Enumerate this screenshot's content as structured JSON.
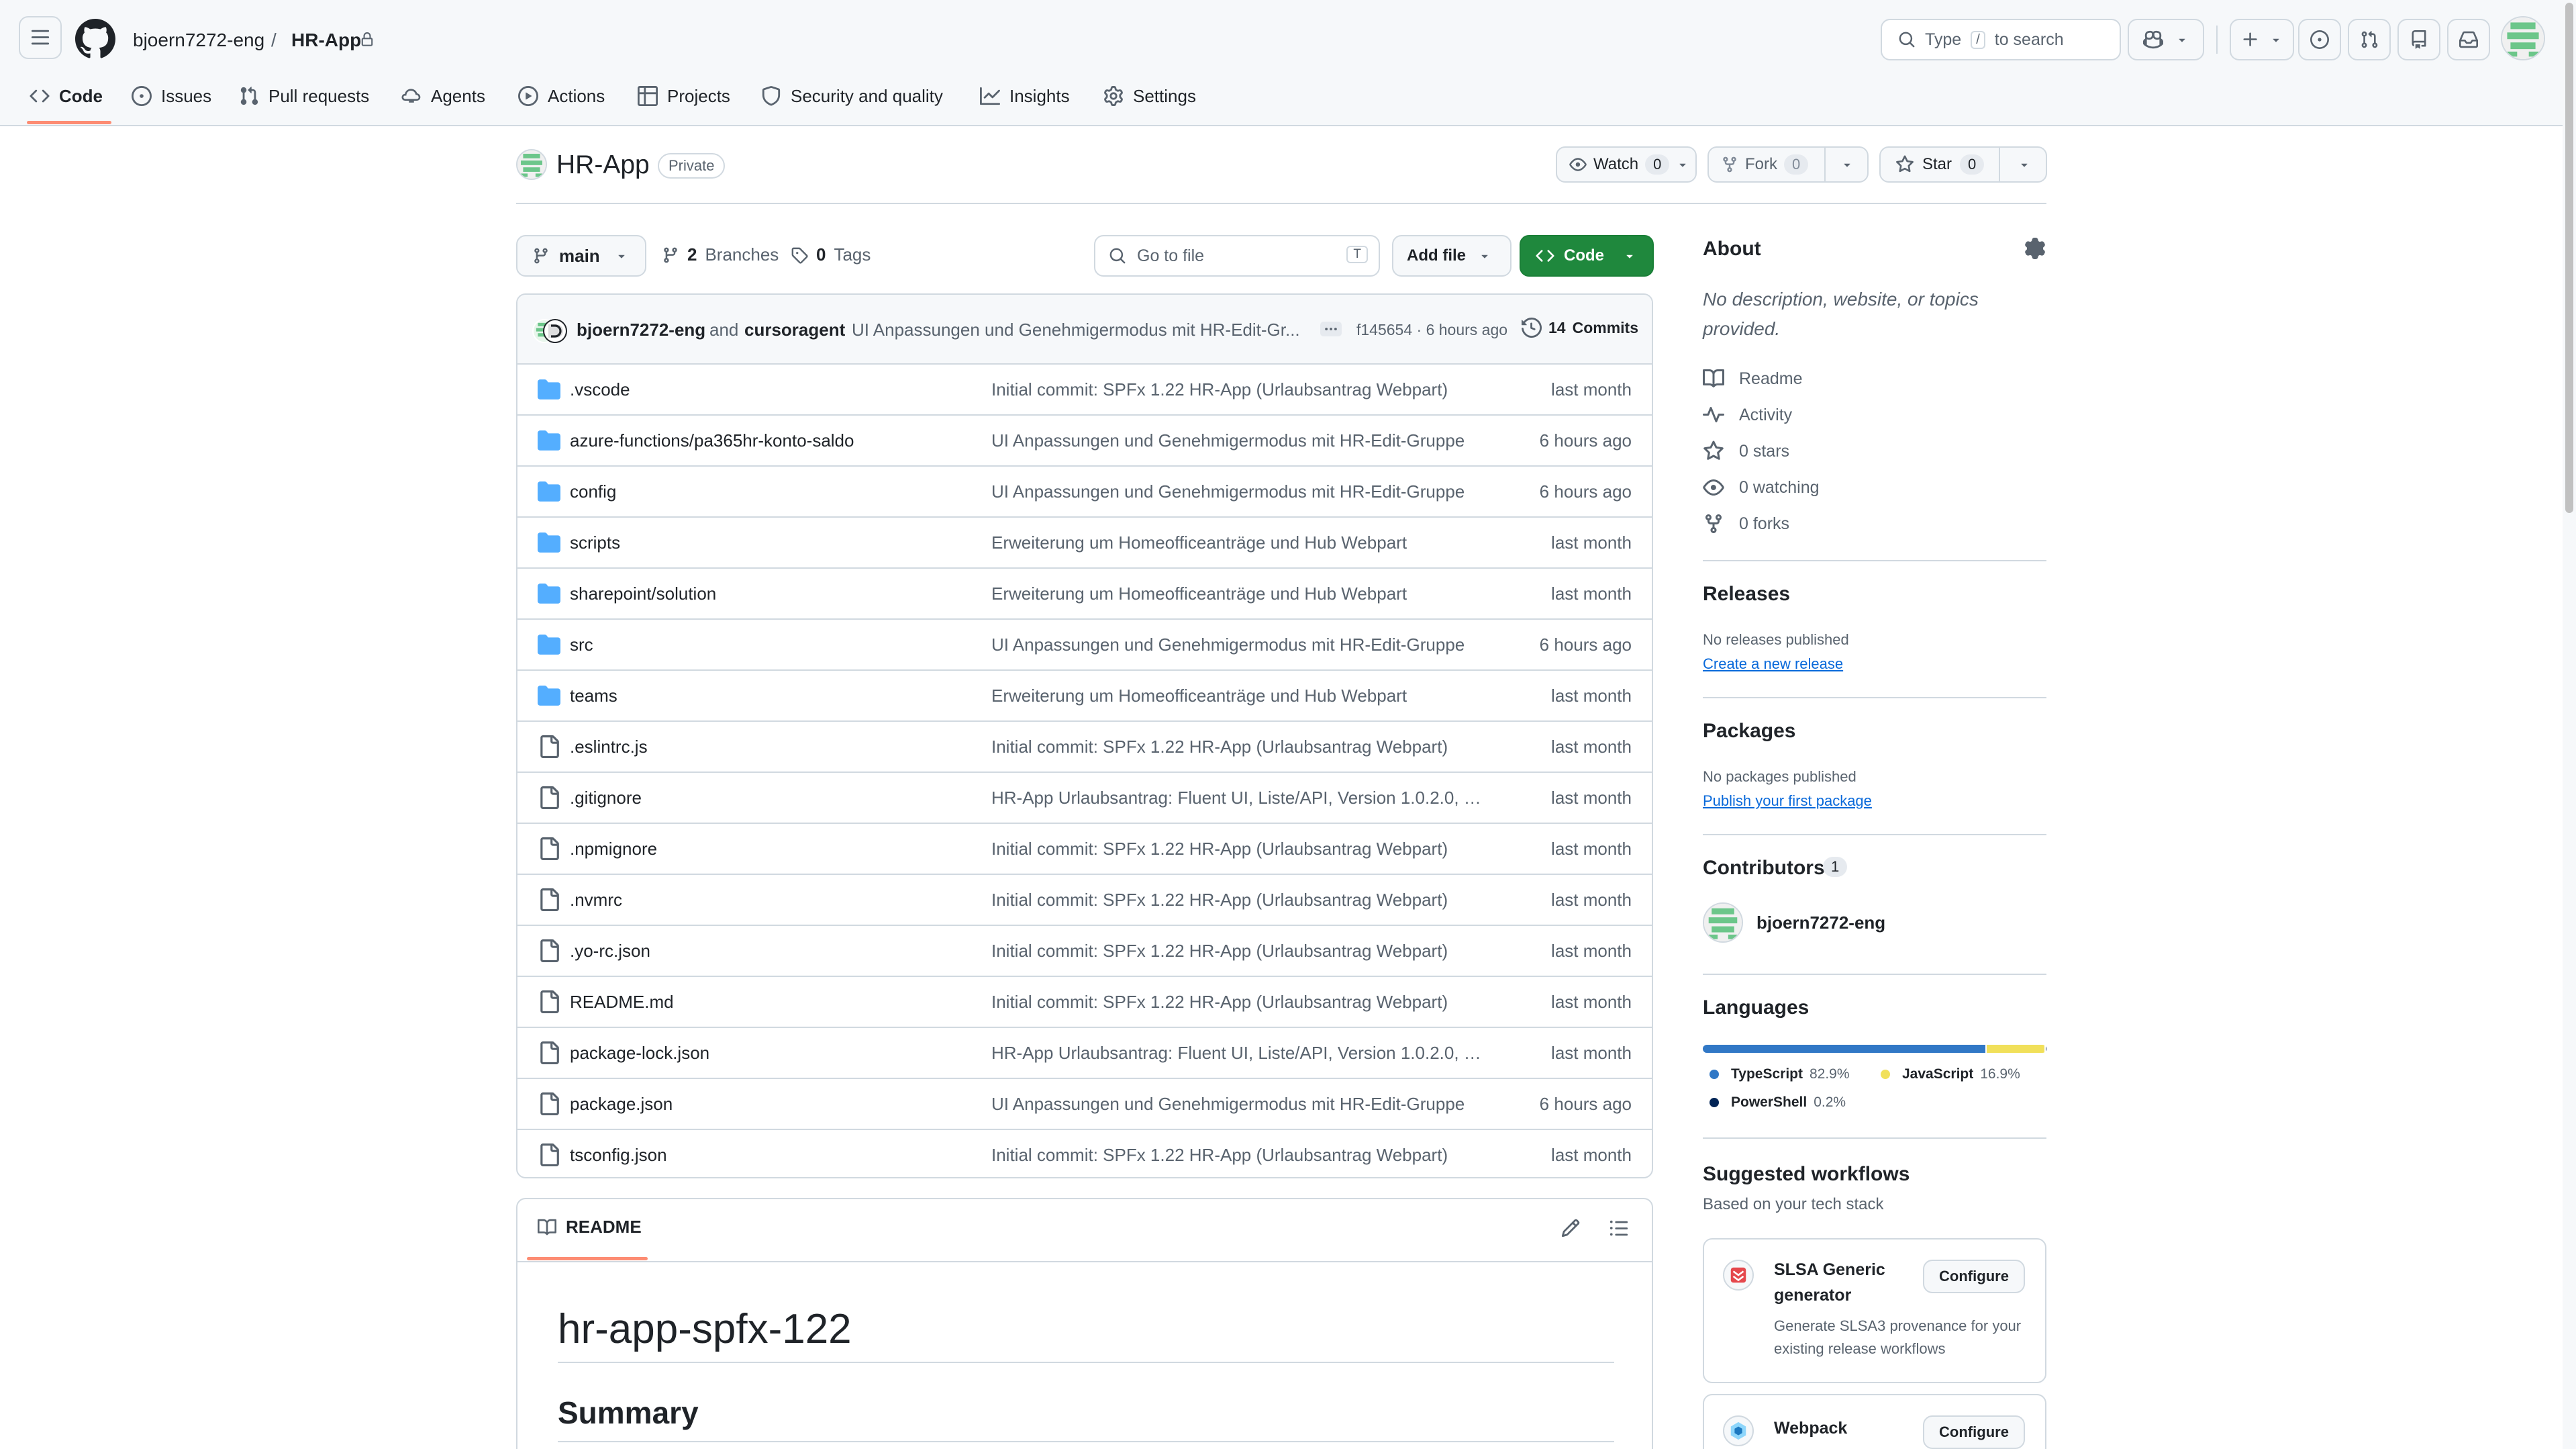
{
  "header": {
    "owner": "bjoern7272-eng",
    "separator": "/",
    "repo": "HR-App",
    "search_prefix": "Type",
    "search_key": "/",
    "search_suffix": "to search"
  },
  "tabs": [
    {
      "label": "Code",
      "icon": "code-icon"
    },
    {
      "label": "Issues",
      "icon": "issue-icon"
    },
    {
      "label": "Pull requests",
      "icon": "pull-request-icon"
    },
    {
      "label": "Agents",
      "icon": "agent-icon"
    },
    {
      "label": "Actions",
      "icon": "play-icon"
    },
    {
      "label": "Projects",
      "icon": "table-icon"
    },
    {
      "label": "Security and quality",
      "icon": "shield-icon"
    },
    {
      "label": "Insights",
      "icon": "graph-icon"
    },
    {
      "label": "Settings",
      "icon": "gear-icon"
    }
  ],
  "repo": {
    "name": "HR-App",
    "visibility": "Private",
    "watch_label": "Watch",
    "watch_count": "0",
    "fork_label": "Fork",
    "fork_count": "0",
    "star_label": "Star",
    "star_count": "0"
  },
  "toolbar": {
    "branch": "main",
    "branches_count": "2",
    "branches_label": "Branches",
    "tags_count": "0",
    "tags_label": "Tags",
    "goto_placeholder": "Go to file",
    "goto_key": "T",
    "add_file": "Add file",
    "code": "Code"
  },
  "commit": {
    "author": "bjoern7272-eng",
    "and": "and",
    "coauthor": "cursoragent",
    "message": "UI Anpassungen und Genehmigermodus mit HR-Edit-Gr...",
    "hash_time": "f145654 · 6 hours ago",
    "commits_count": "14",
    "commits_label": "Commits"
  },
  "files": [
    {
      "name": ".vscode",
      "type": "dir",
      "message": "Initial commit: SPFx 1.22 HR-App (Urlaubsantrag Webpart)",
      "date": "last month"
    },
    {
      "name": "azure-functions/pa365hr-konto-saldo",
      "type": "dir",
      "message": "UI Anpassungen und Genehmigermodus mit HR-Edit-Gruppe",
      "date": "6 hours ago"
    },
    {
      "name": "config",
      "type": "dir",
      "message": "UI Anpassungen und Genehmigermodus mit HR-Edit-Gruppe",
      "date": "6 hours ago"
    },
    {
      "name": "scripts",
      "type": "dir",
      "message": "Erweiterung um Homeofficeanträge und Hub Webpart",
      "date": "last month"
    },
    {
      "name": "sharepoint/solution",
      "type": "dir",
      "message": "Erweiterung um Homeofficeanträge und Hub Webpart",
      "date": "last month"
    },
    {
      "name": "src",
      "type": "dir",
      "message": "UI Anpassungen und Genehmigermodus mit HR-Edit-Gruppe",
      "date": "6 hours ago"
    },
    {
      "name": "teams",
      "type": "dir",
      "message": "Erweiterung um Homeofficeanträge und Hub Webpart",
      "date": "last month"
    },
    {
      "name": ".eslintrc.js",
      "type": "file",
      "message": "Initial commit: SPFx 1.22 HR-App (Urlaubsantrag Webpart)",
      "date": "last month"
    },
    {
      "name": ".gitignore",
      "type": "file",
      "message": "HR-App Urlaubsantrag: Fluent UI, Liste/API, Version 1.0.2.0, B...",
      "date": "last month"
    },
    {
      "name": ".npmignore",
      "type": "file",
      "message": "Initial commit: SPFx 1.22 HR-App (Urlaubsantrag Webpart)",
      "date": "last month"
    },
    {
      "name": ".nvmrc",
      "type": "file",
      "message": "Initial commit: SPFx 1.22 HR-App (Urlaubsantrag Webpart)",
      "date": "last month"
    },
    {
      "name": ".yo-rc.json",
      "type": "file",
      "message": "Initial commit: SPFx 1.22 HR-App (Urlaubsantrag Webpart)",
      "date": "last month"
    },
    {
      "name": "README.md",
      "type": "file",
      "message": "Initial commit: SPFx 1.22 HR-App (Urlaubsantrag Webpart)",
      "date": "last month"
    },
    {
      "name": "package-lock.json",
      "type": "file",
      "message": "HR-App Urlaubsantrag: Fluent UI, Liste/API, Version 1.0.2.0, B...",
      "date": "last month"
    },
    {
      "name": "package.json",
      "type": "file",
      "message": "UI Anpassungen und Genehmigermodus mit HR-Edit-Gruppe",
      "date": "6 hours ago"
    },
    {
      "name": "tsconfig.json",
      "type": "file",
      "message": "Initial commit: SPFx 1.22 HR-App (Urlaubsantrag Webpart)",
      "date": "last month"
    }
  ],
  "readme": {
    "tab": "README",
    "h1": "hr-app-spfx-122",
    "h2": "Summary"
  },
  "about": {
    "title": "About",
    "description": "No description, website, or topics provided.",
    "items": [
      {
        "label": "Readme",
        "icon": "book-icon"
      },
      {
        "label": "Activity",
        "icon": "pulse-icon"
      },
      {
        "label": "0 stars",
        "icon": "star-icon"
      },
      {
        "label": "0 watching",
        "icon": "eye-icon"
      },
      {
        "label": "0 forks",
        "icon": "fork-icon"
      }
    ]
  },
  "releases": {
    "title": "Releases",
    "empty": "No releases published",
    "link": "Create a new release"
  },
  "packages": {
    "title": "Packages",
    "empty": "No packages published",
    "link": "Publish your first package"
  },
  "contributors": {
    "title": "Contributors",
    "count": "1",
    "user": "bjoern7272-eng"
  },
  "languages": {
    "title": "Languages",
    "items": [
      {
        "name": "TypeScript",
        "percent": "82.9%",
        "value": 82.9,
        "color": "#3178c6"
      },
      {
        "name": "JavaScript",
        "percent": "16.9%",
        "value": 16.9,
        "color": "#f1e05a"
      },
      {
        "name": "PowerShell",
        "percent": "0.2%",
        "value": 0.2,
        "color": "#012456"
      }
    ]
  },
  "workflows": {
    "title": "Suggested workflows",
    "subtitle": "Based on your tech stack",
    "items": [
      {
        "name": "SLSA Generic generator",
        "desc": "Generate SLSA3 provenance for your existing release workflows",
        "button": "Configure"
      },
      {
        "name": "Webpack",
        "desc": "",
        "button": "Configure"
      }
    ]
  },
  "colors": {
    "accent": "#1f883d",
    "link": "#0969da",
    "tab_underline": "#fd8c73",
    "border": "#d1d9e0"
  }
}
